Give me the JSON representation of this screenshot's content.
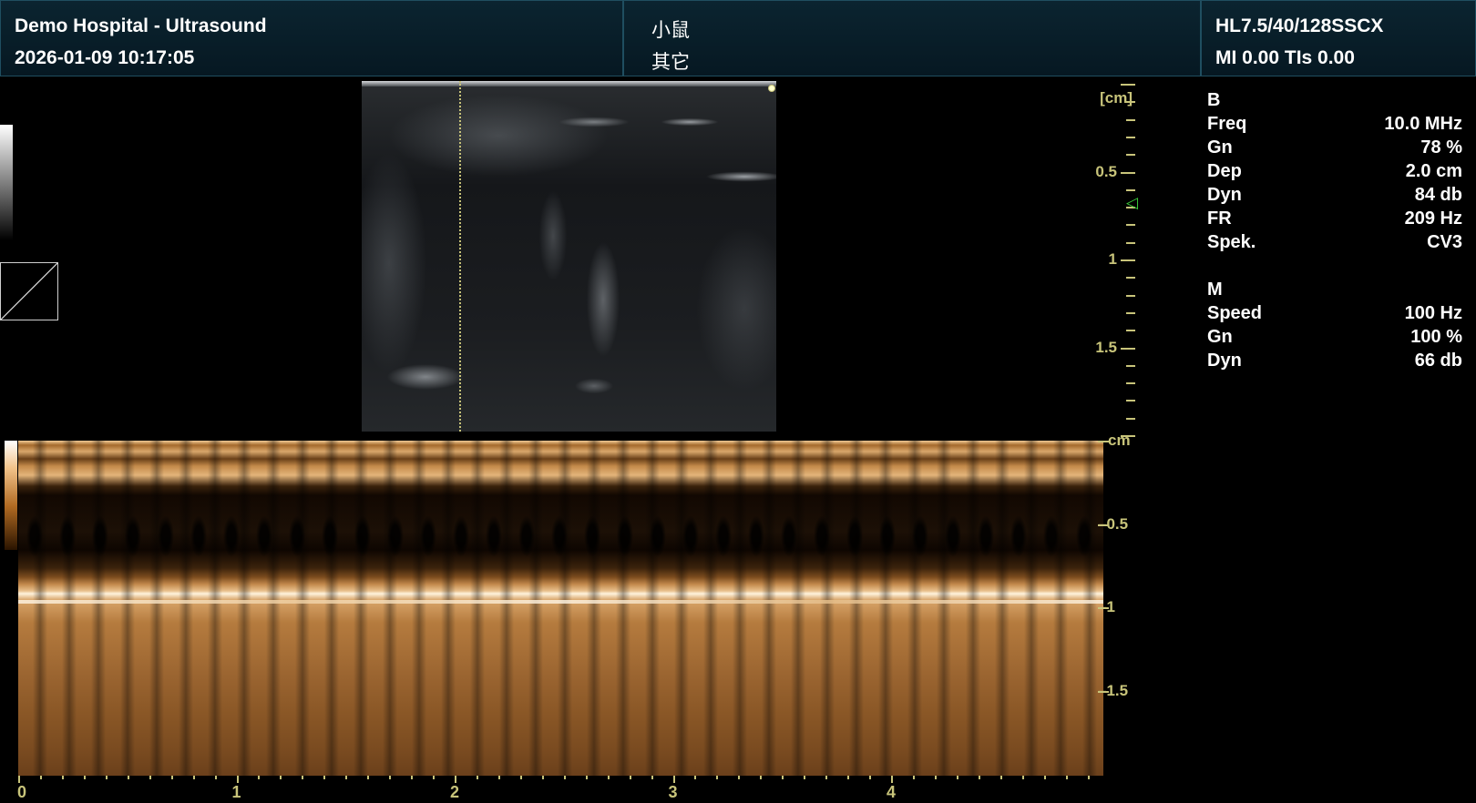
{
  "header": {
    "left": {
      "title": "Demo Hospital - Ultrasound",
      "datetime": "2026-01-09 10:17:05"
    },
    "middle": {
      "line1": "小鼠",
      "line2": "其它"
    },
    "right": {
      "probe": "HL7.5/40/128SSCX",
      "indices": "MI 0.00  TIs 0.00"
    }
  },
  "bmode_scale": {
    "unit": "[cm]",
    "labels": [
      {
        "depth": 0.5,
        "text": "0.5"
      },
      {
        "depth": 1,
        "text": "1"
      },
      {
        "depth": 1.5,
        "text": "1.5"
      }
    ]
  },
  "mmode_scale": {
    "unit": "cm",
    "labels": [
      {
        "depth": 0.5,
        "text": "0.5"
      },
      {
        "depth": 1,
        "text": "1"
      },
      {
        "depth": 1.5,
        "text": "1.5"
      }
    ]
  },
  "time_axis": {
    "labels": [
      "0",
      "1",
      "2",
      "3",
      "4"
    ]
  },
  "params": {
    "b_title": "B",
    "b_rows": [
      {
        "name": "Freq",
        "value": "10.0 MHz"
      },
      {
        "name": "Gn",
        "value": "78 %"
      },
      {
        "name": "Dep",
        "value": "2.0 cm"
      },
      {
        "name": "Dyn",
        "value": "84 db"
      },
      {
        "name": "FR",
        "value": "209 Hz"
      },
      {
        "name": "Spek.",
        "value": "CV3"
      }
    ],
    "m_title": "M",
    "m_rows": [
      {
        "name": "Speed",
        "value": "100 Hz"
      },
      {
        "name": "Gn",
        "value": "100 %"
      },
      {
        "name": "Dyn",
        "value": "66 db"
      }
    ]
  },
  "colors": {
    "scale_color": "#c8c47a",
    "focus_marker": "#3ad03a",
    "header_border": "#1f4e60"
  },
  "icons": {
    "focus_marker": "triangle-left-icon"
  }
}
